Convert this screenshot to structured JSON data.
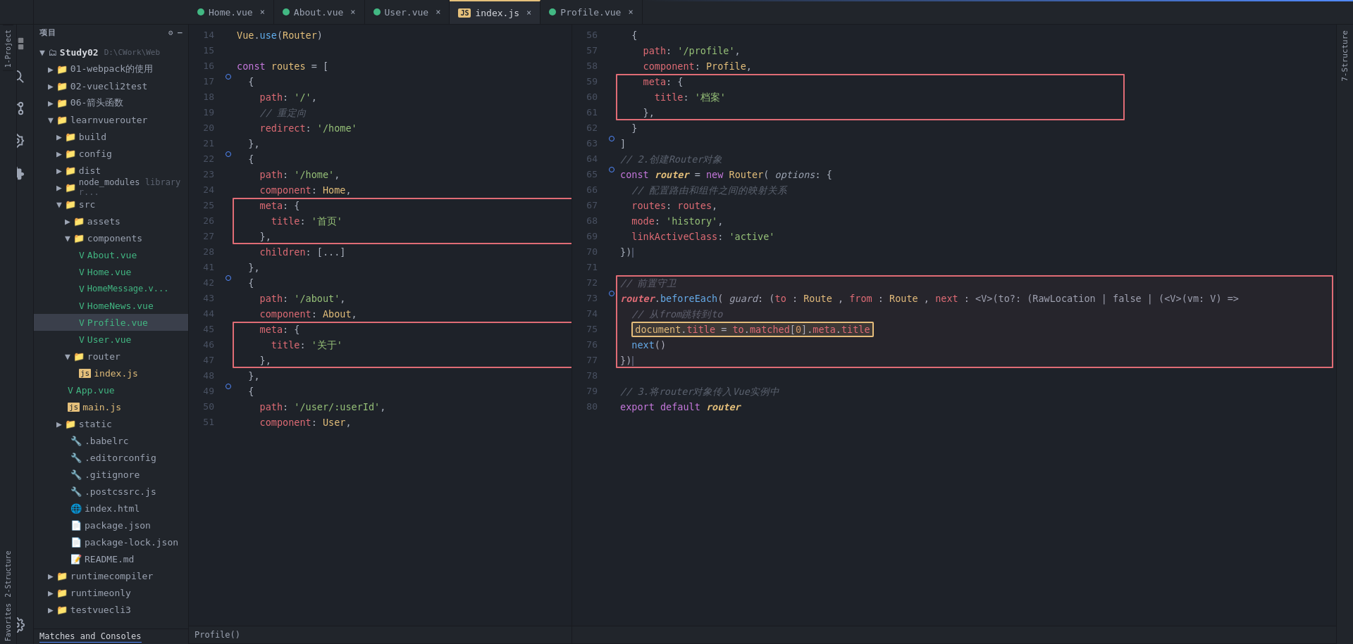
{
  "tabs": [
    {
      "id": "home-vue",
      "label": "Home.vue",
      "type": "vue",
      "active": false,
      "closable": true
    },
    {
      "id": "about-vue",
      "label": "About.vue",
      "type": "vue",
      "active": false,
      "closable": true
    },
    {
      "id": "user-vue",
      "label": "User.vue",
      "type": "vue",
      "active": false,
      "closable": true
    },
    {
      "id": "index-js",
      "label": "index.js",
      "type": "js",
      "active": true,
      "closable": true
    },
    {
      "id": "profile-vue",
      "label": "Profile.vue",
      "type": "vue",
      "active": false,
      "closable": true
    }
  ],
  "sidebar": {
    "title": "项目",
    "items": [
      {
        "id": "study02",
        "label": "Study02 D:\\CWork\\Web",
        "type": "project",
        "indent": 0,
        "expanded": true
      },
      {
        "id": "webpack",
        "label": "01-webpack的使用",
        "type": "folder",
        "indent": 1,
        "expanded": false
      },
      {
        "id": "vuecli2test",
        "label": "02-vuecli2test",
        "type": "folder",
        "indent": 1,
        "expanded": false
      },
      {
        "id": "jiantou",
        "label": "06-箭头函数",
        "type": "folder",
        "indent": 1,
        "expanded": false
      },
      {
        "id": "learnvuerouter",
        "label": "learnvuerouter",
        "type": "folder",
        "indent": 1,
        "expanded": true
      },
      {
        "id": "build",
        "label": "build",
        "type": "folder",
        "indent": 2,
        "expanded": false
      },
      {
        "id": "config",
        "label": "config",
        "type": "folder",
        "indent": 2,
        "expanded": false
      },
      {
        "id": "dist",
        "label": "dist",
        "type": "folder",
        "indent": 2,
        "expanded": false
      },
      {
        "id": "node_modules",
        "label": "node_modules library r...",
        "type": "folder",
        "indent": 2,
        "expanded": false
      },
      {
        "id": "src",
        "label": "src",
        "type": "folder",
        "indent": 2,
        "expanded": true
      },
      {
        "id": "assets",
        "label": "assets",
        "type": "folder",
        "indent": 3,
        "expanded": false
      },
      {
        "id": "components",
        "label": "components",
        "type": "folder",
        "indent": 3,
        "expanded": true
      },
      {
        "id": "about-vue",
        "label": "About.vue",
        "type": "vue",
        "indent": 4
      },
      {
        "id": "home-vue",
        "label": "Home.vue",
        "type": "vue",
        "indent": 4
      },
      {
        "id": "homemessage-vue",
        "label": "HomeMessage.v...",
        "type": "vue",
        "indent": 4
      },
      {
        "id": "homenews-vue",
        "label": "HomeNews.vue",
        "type": "vue",
        "indent": 4
      },
      {
        "id": "profile-vue",
        "label": "Profile.vue",
        "type": "vue",
        "indent": 4,
        "selected": true
      },
      {
        "id": "user-vue",
        "label": "User.vue",
        "type": "vue",
        "indent": 4
      },
      {
        "id": "router",
        "label": "router",
        "type": "folder",
        "indent": 3,
        "expanded": true
      },
      {
        "id": "index-js",
        "label": "index.js",
        "type": "js",
        "indent": 4
      },
      {
        "id": "app-vue",
        "label": "App.vue",
        "type": "vue",
        "indent": 3
      },
      {
        "id": "main-js",
        "label": "main.js",
        "type": "js",
        "indent": 3
      },
      {
        "id": "static",
        "label": "static",
        "type": "folder",
        "indent": 2,
        "expanded": false
      },
      {
        "id": "babelrc",
        "label": ".babelrc",
        "type": "txt",
        "indent": 2
      },
      {
        "id": "editorconfig",
        "label": ".editorconfig",
        "type": "txt",
        "indent": 2
      },
      {
        "id": "gitignore",
        "label": ".gitignore",
        "type": "txt",
        "indent": 2
      },
      {
        "id": "postcssrc",
        "label": ".postcssrc.js",
        "type": "js",
        "indent": 2
      },
      {
        "id": "index-html",
        "label": "index.html",
        "type": "html",
        "indent": 2
      },
      {
        "id": "package-json",
        "label": "package.json",
        "type": "json",
        "indent": 2
      },
      {
        "id": "package-lock-json",
        "label": "package-lock.json",
        "type": "json",
        "indent": 2
      },
      {
        "id": "readme",
        "label": "README.md",
        "type": "md",
        "indent": 2
      },
      {
        "id": "runtimecompiler",
        "label": "runtimecompiler",
        "type": "folder",
        "indent": 1,
        "expanded": false
      },
      {
        "id": "runtimeonly",
        "label": "runtimeonly",
        "type": "folder",
        "indent": 1,
        "expanded": false
      },
      {
        "id": "testvuecli3",
        "label": "testvuecli3",
        "type": "folder",
        "indent": 1,
        "expanded": false
      }
    ]
  },
  "left_code": {
    "lines": [
      {
        "num": 14,
        "gutter": false,
        "code": "Vue.use(Router)"
      },
      {
        "num": 15,
        "gutter": false,
        "code": ""
      },
      {
        "num": 16,
        "gutter": false,
        "code": "const routes = ["
      },
      {
        "num": 17,
        "gutter": false,
        "code": "  {"
      },
      {
        "num": 18,
        "gutter": false,
        "code": "    path: '/',"
      },
      {
        "num": 19,
        "gutter": false,
        "code": "    // 重定向"
      },
      {
        "num": 20,
        "gutter": false,
        "code": "    redirect: '/home'"
      },
      {
        "num": 21,
        "gutter": false,
        "code": "  },"
      },
      {
        "num": 22,
        "gutter": true,
        "code": "  {"
      },
      {
        "num": 23,
        "gutter": false,
        "code": "    path: '/home',"
      },
      {
        "num": 24,
        "gutter": false,
        "code": "    component: Home,"
      },
      {
        "num": 25,
        "gutter": false,
        "code": "    meta: {",
        "redbox": true
      },
      {
        "num": 26,
        "gutter": false,
        "code": "      title: '首页'"
      },
      {
        "num": 27,
        "gutter": false,
        "code": "    },"
      },
      {
        "num": 28,
        "gutter": false,
        "code": "    children: [...]"
      },
      {
        "num": 41,
        "gutter": false,
        "code": "  },"
      },
      {
        "num": 42,
        "gutter": true,
        "code": "  {"
      },
      {
        "num": 43,
        "gutter": false,
        "code": "    path: '/about',"
      },
      {
        "num": 44,
        "gutter": false,
        "code": "    component: About,"
      },
      {
        "num": 45,
        "gutter": false,
        "code": "    meta: {",
        "redbox": true
      },
      {
        "num": 46,
        "gutter": false,
        "code": "      title: '关于'"
      },
      {
        "num": 47,
        "gutter": false,
        "code": "    },"
      },
      {
        "num": 48,
        "gutter": false,
        "code": "  },"
      },
      {
        "num": 49,
        "gutter": true,
        "code": "  {"
      },
      {
        "num": 50,
        "gutter": false,
        "code": "    path: '/user/:userId',"
      },
      {
        "num": 51,
        "gutter": false,
        "code": "    component: User,"
      }
    ]
  },
  "right_code": {
    "lines": [
      {
        "num": 56,
        "gutter": false,
        "code": "  {"
      },
      {
        "num": 57,
        "gutter": false,
        "code": "    path: '/profile',"
      },
      {
        "num": 58,
        "gutter": false,
        "code": "    component: Profile,"
      },
      {
        "num": 59,
        "gutter": false,
        "code": "    meta: {",
        "redbox_start": true
      },
      {
        "num": 60,
        "gutter": false,
        "code": "      title: '档案'"
      },
      {
        "num": 61,
        "gutter": false,
        "code": "    },"
      },
      {
        "num": 62,
        "gutter": false,
        "code": "  }"
      },
      {
        "num": 63,
        "gutter": false,
        "code": "]"
      },
      {
        "num": 64,
        "gutter": false,
        "code": "// 2.创建Router对象"
      },
      {
        "num": 65,
        "gutter": true,
        "code": "const router = new Router( options: {"
      },
      {
        "num": 66,
        "gutter": false,
        "code": "  // 配置路由和组件之间的映射关系"
      },
      {
        "num": 67,
        "gutter": false,
        "code": "  routes: routes,"
      },
      {
        "num": 68,
        "gutter": false,
        "code": "  mode: 'history',"
      },
      {
        "num": 69,
        "gutter": false,
        "code": "  linkActiveClass: 'active'"
      },
      {
        "num": 70,
        "gutter": false,
        "code": "})"
      },
      {
        "num": 71,
        "gutter": false,
        "code": ""
      },
      {
        "num": 72,
        "gutter": false,
        "code": "// 前置守卫",
        "redbox_section_start": true
      },
      {
        "num": 73,
        "gutter": true,
        "code": "router.beforeEach( guard: (to : Route , from : Route , next : <V>(to?: (RawLocation | false | (<V>(vm: V) =>"
      },
      {
        "num": 74,
        "gutter": false,
        "code": "  // 从from跳转到to"
      },
      {
        "num": 75,
        "gutter": false,
        "code": "  document.title = to.matched[0].meta.title",
        "yellowbox": true
      },
      {
        "num": 76,
        "gutter": false,
        "code": "  next()"
      },
      {
        "num": 77,
        "gutter": false,
        "code": "})"
      },
      {
        "num": 78,
        "gutter": false,
        "code": ""
      },
      {
        "num": 79,
        "gutter": false,
        "code": "// 3.将router对象传入Vue实例中"
      },
      {
        "num": 80,
        "gutter": false,
        "code": "export default router"
      }
    ]
  },
  "breadcrumb": "Profile()",
  "bottom_tabs": [
    "Matches and Consoles"
  ],
  "side_icons": {
    "top": [
      "📁",
      "🔍",
      "⚙",
      "🐛",
      "📦"
    ],
    "bottom_labels": [
      "1-Project",
      "2-Structure",
      "7-Structure"
    ]
  }
}
